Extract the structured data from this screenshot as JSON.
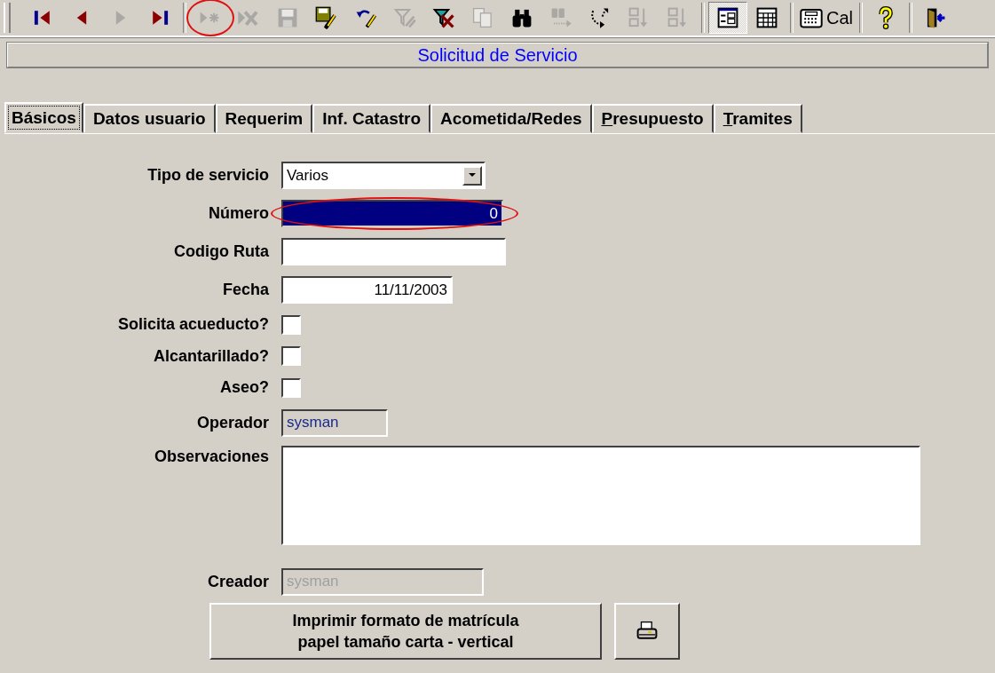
{
  "toolbar": {
    "buttons": [
      {
        "kind": "first",
        "disabled": false,
        "pressed": false,
        "highlighted": false
      },
      {
        "kind": "prev",
        "disabled": false,
        "pressed": false,
        "highlighted": false
      },
      {
        "kind": "next",
        "disabled": true,
        "pressed": false,
        "highlighted": false
      },
      {
        "kind": "last",
        "disabled": false,
        "pressed": false,
        "highlighted": false
      },
      {
        "kind": "separator"
      },
      {
        "kind": "newrecord",
        "disabled": true,
        "pressed": false,
        "highlighted": true
      },
      {
        "kind": "deleterecord",
        "disabled": true,
        "pressed": false,
        "highlighted": false
      },
      {
        "kind": "save",
        "disabled": true,
        "pressed": false,
        "highlighted": false
      },
      {
        "kind": "saveedit",
        "disabled": false,
        "pressed": false,
        "highlighted": false
      },
      {
        "kind": "undoedit",
        "disabled": false,
        "pressed": false,
        "highlighted": false
      },
      {
        "kind": "filter",
        "disabled": true,
        "pressed": false,
        "highlighted": false
      },
      {
        "kind": "removefilter",
        "disabled": false,
        "pressed": false,
        "highlighted": false
      },
      {
        "kind": "copy",
        "disabled": true,
        "pressed": false,
        "highlighted": false
      },
      {
        "kind": "find",
        "disabled": false,
        "pressed": false,
        "highlighted": false
      },
      {
        "kind": "findnext",
        "disabled": true,
        "pressed": false,
        "highlighted": false
      },
      {
        "kind": "replace",
        "disabled": false,
        "pressed": false,
        "highlighted": false
      },
      {
        "kind": "sortasc",
        "disabled": true,
        "pressed": false,
        "highlighted": false
      },
      {
        "kind": "sortdesc",
        "disabled": true,
        "pressed": false,
        "highlighted": false
      },
      {
        "kind": "separator"
      },
      {
        "kind": "formview",
        "disabled": false,
        "pressed": true,
        "highlighted": false
      },
      {
        "kind": "datasheet",
        "disabled": false,
        "pressed": false,
        "highlighted": false
      },
      {
        "kind": "separator"
      },
      {
        "kind": "calculator",
        "label": "Cal",
        "disabled": false,
        "pressed": false,
        "highlighted": false
      },
      {
        "kind": "separator"
      },
      {
        "kind": "help",
        "disabled": false,
        "pressed": false,
        "highlighted": false
      },
      {
        "kind": "separator"
      },
      {
        "kind": "exit",
        "disabled": false,
        "pressed": false,
        "highlighted": false
      }
    ]
  },
  "form_title": "Solicitud de Servicio",
  "tabs": [
    {
      "label": "Básicos",
      "selected": true,
      "underline_first": false
    },
    {
      "label": "Datos usuario",
      "selected": false,
      "underline_first": false
    },
    {
      "label": "Requerim",
      "selected": false,
      "underline_first": false
    },
    {
      "label": "Inf. Catastro",
      "selected": false,
      "underline_first": false
    },
    {
      "label": "Acometida/Redes",
      "selected": false,
      "underline_first": false
    },
    {
      "label": "Presupuesto",
      "selected": false,
      "underline_first": true
    },
    {
      "label": "Tramites",
      "selected": false,
      "underline_first": true
    }
  ],
  "fields": [
    {
      "kind": "select",
      "label": "Tipo de servicio",
      "value": "Varios",
      "focused": false,
      "locked": false,
      "disabled": false,
      "highlighted": false
    },
    {
      "kind": "text",
      "label": "Número",
      "value": "0",
      "focused": true,
      "locked": false,
      "disabled": false,
      "highlighted": true
    },
    {
      "kind": "text",
      "label": "Codigo Ruta",
      "focused": false,
      "locked": false,
      "disabled": false,
      "highlighted": false
    },
    {
      "kind": "text",
      "label": "Fecha",
      "value": "11/11/2003",
      "focused": false,
      "locked": false,
      "disabled": false,
      "highlighted": false
    },
    {
      "kind": "checkbox",
      "label": "Solicita acueducto?",
      "checked": false
    },
    {
      "kind": "checkbox",
      "label": "Alcantarillado?",
      "checked": false
    },
    {
      "kind": "checkbox",
      "label": "Aseo?",
      "checked": false
    },
    {
      "kind": "text",
      "label": "Operador",
      "value": "sysman",
      "focused": false,
      "locked": true,
      "disabled": false,
      "highlighted": false
    },
    {
      "kind": "memo",
      "label": "Observaciones",
      "focused": false,
      "locked": false,
      "disabled": false,
      "highlighted": false
    },
    {
      "kind": "text",
      "label": "Creador",
      "value": "sysman",
      "focused": false,
      "locked": false,
      "disabled": true,
      "highlighted": false
    }
  ],
  "print_button": {
    "label": "Imprimir formato de matrícula\npapel tamaño carta - vertical"
  }
}
